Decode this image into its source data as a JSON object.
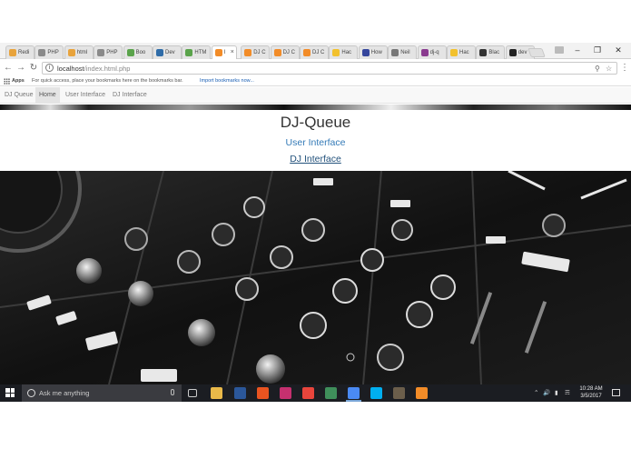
{
  "browser": {
    "tabs": [
      {
        "label": "Redi",
        "color": "#e8a33c"
      },
      {
        "label": "PHP",
        "color": "#8a8a8a"
      },
      {
        "label": "html",
        "color": "#e8a33c"
      },
      {
        "label": "PHP",
        "color": "#8a8a8a"
      },
      {
        "label": "Boo",
        "color": "#5aa34b"
      },
      {
        "label": "Dev",
        "color": "#2f6ca8"
      },
      {
        "label": "HTM",
        "color": "#5aa34b"
      },
      {
        "label": "I",
        "color": "#f28c28",
        "active": true
      },
      {
        "label": "DJ C",
        "color": "#f28c28"
      },
      {
        "label": "DJ C",
        "color": "#f28c28"
      },
      {
        "label": "DJ C",
        "color": "#f28c28"
      },
      {
        "label": "Hac",
        "color": "#f2c12e"
      },
      {
        "label": "How",
        "color": "#35469c"
      },
      {
        "label": "Neil",
        "color": "#777777"
      },
      {
        "label": "dj-q",
        "color": "#8a3b8f"
      },
      {
        "label": "Hac",
        "color": "#f2c12e"
      },
      {
        "label": "Blac",
        "color": "#333333"
      },
      {
        "label": "dev",
        "color": "#222222"
      }
    ],
    "address_host": "localhost",
    "address_path": "/index.html.php",
    "bookmarks_apps": "Apps",
    "bookmarks_hint": "For quick access, place your bookmarks here on the bookmarks bar.",
    "bookmarks_import": "Import bookmarks now..."
  },
  "site": {
    "brand": "DJ Queue",
    "nav": [
      {
        "label": "Home",
        "active": true
      },
      {
        "label": "User Interface",
        "active": false
      },
      {
        "label": "DJ Interface",
        "active": false
      }
    ],
    "title": "DJ-Queue",
    "link_user": "User Interface",
    "link_dj": "DJ Interface"
  },
  "taskbar": {
    "search_placeholder": "Ask me anything",
    "apps": [
      {
        "name": "task-view-icon",
        "color": "#1b1d22"
      },
      {
        "name": "file-explorer-icon",
        "color": "#e9b949"
      },
      {
        "name": "word-icon",
        "color": "#2b579a"
      },
      {
        "name": "ubuntu-icon",
        "color": "#e95420"
      },
      {
        "name": "intellij-icon",
        "color": "#c5306f"
      },
      {
        "name": "chrome-icon",
        "color": "#e8453c"
      },
      {
        "name": "photo-icon",
        "color": "#3f8f5b"
      },
      {
        "name": "chrome-active-icon",
        "color": "#4a8af4",
        "active": true
      },
      {
        "name": "skype-icon",
        "color": "#00aff0"
      },
      {
        "name": "media-icon",
        "color": "#6b5e4b"
      },
      {
        "name": "sublime-icon",
        "color": "#f28c28"
      }
    ],
    "time": "10:28 AM",
    "date": "3/5/2017"
  }
}
